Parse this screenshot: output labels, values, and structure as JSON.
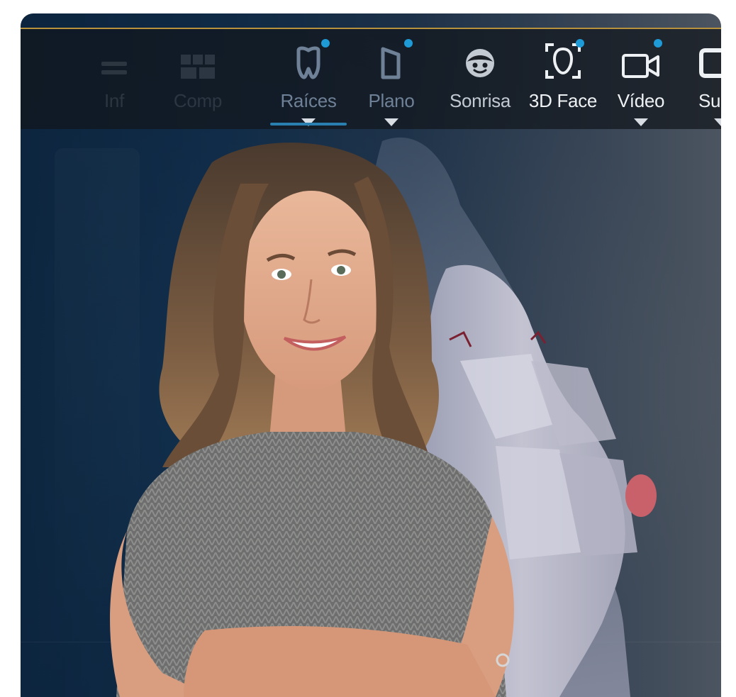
{
  "toolbar": {
    "items": [
      {
        "label": "Inf",
        "icon": "info-icon"
      },
      {
        "label": "Comp",
        "icon": "grid-icon"
      },
      {
        "label": "Raíces",
        "icon": "tooth-roots-icon",
        "badge": true,
        "dropdown": true,
        "active": true
      },
      {
        "label": "Plano",
        "icon": "plane-icon",
        "badge": true,
        "dropdown": true
      },
      {
        "label": "Sonrisa",
        "icon": "smile-face-icon"
      },
      {
        "label": "3D Face",
        "icon": "face-scan-icon",
        "badge": true
      },
      {
        "label": "Vídeo",
        "icon": "video-camera-icon",
        "badge": true,
        "dropdown": true
      },
      {
        "label": "Su",
        "icon": "partial-icon",
        "dropdown": true
      }
    ]
  },
  "colors": {
    "accent": "#1e9ad6",
    "active_underline": "#2a7fb1",
    "top_border": "#b8913c",
    "background_dark": "#0e2842",
    "background_light": "#6f7276"
  }
}
